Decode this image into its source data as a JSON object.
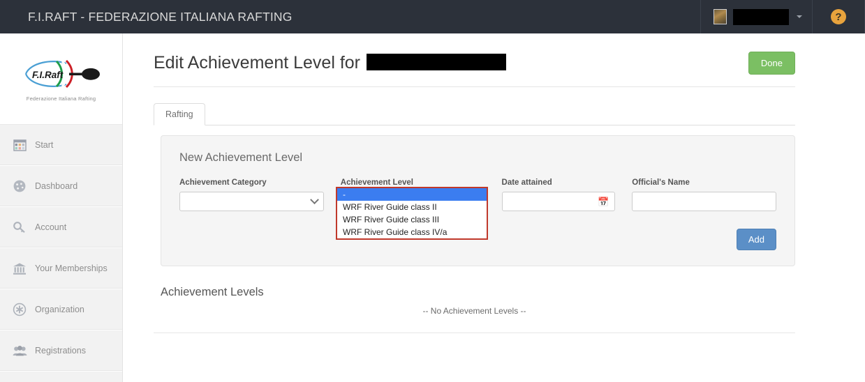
{
  "navbar": {
    "brand": "F.I.RAFT - FEDERAZIONE ITALIANA RAFTING",
    "user_name": "",
    "help_glyph": "?",
    "background_color": "#2c313a"
  },
  "sidebar": {
    "logo_text": "F.I.Raft",
    "logo_subtitle": "Federazione Italiana Rafting",
    "items": [
      {
        "label": "Start",
        "icon": "grid-dashboard-icon"
      },
      {
        "label": "Dashboard",
        "icon": "gauge-icon"
      },
      {
        "label": "Account",
        "icon": "key-icon"
      },
      {
        "label": "Your Memberships",
        "icon": "bank-icon"
      },
      {
        "label": "Organization",
        "icon": "asterisk-circle-icon"
      },
      {
        "label": "Registrations",
        "icon": "people-group-icon"
      }
    ]
  },
  "page": {
    "title_prefix": "Edit Achievement Level for",
    "title_redacted_name": "",
    "done_label": "Done"
  },
  "tabs": [
    {
      "label": "Rafting",
      "active": true
    }
  ],
  "form": {
    "panel_title": "New Achievement Level",
    "fields": {
      "category": {
        "label": "Achievement Category",
        "value": "",
        "type": "select"
      },
      "level": {
        "label": "Achievement Level",
        "value": "-",
        "type": "select",
        "open": true
      },
      "date": {
        "label": "Date attained",
        "value": "",
        "type": "date",
        "icon": "calendar-icon"
      },
      "official": {
        "label": "Official's Name",
        "value": "",
        "type": "text"
      }
    },
    "level_options": [
      {
        "label": "-",
        "selected": true
      },
      {
        "label": "WRF River Guide class II",
        "selected": false
      },
      {
        "label": "WRF River Guide class III",
        "selected": false
      },
      {
        "label": "WRF River Guide class IV/a",
        "selected": false
      }
    ],
    "add_label": "Add",
    "dropdown_border_color": "#c0392b",
    "dropdown_highlight_color": "#3b7df0"
  },
  "levels_section": {
    "heading": "Achievement Levels",
    "empty_message": "-- No Achievement Levels --"
  },
  "colors": {
    "done_green": "#7bbf63",
    "add_blue": "#5b8fc7",
    "help_orange": "#e8a33d",
    "panel_bg": "#f5f5f5",
    "sidebar_bg": "#f2f2f2"
  }
}
